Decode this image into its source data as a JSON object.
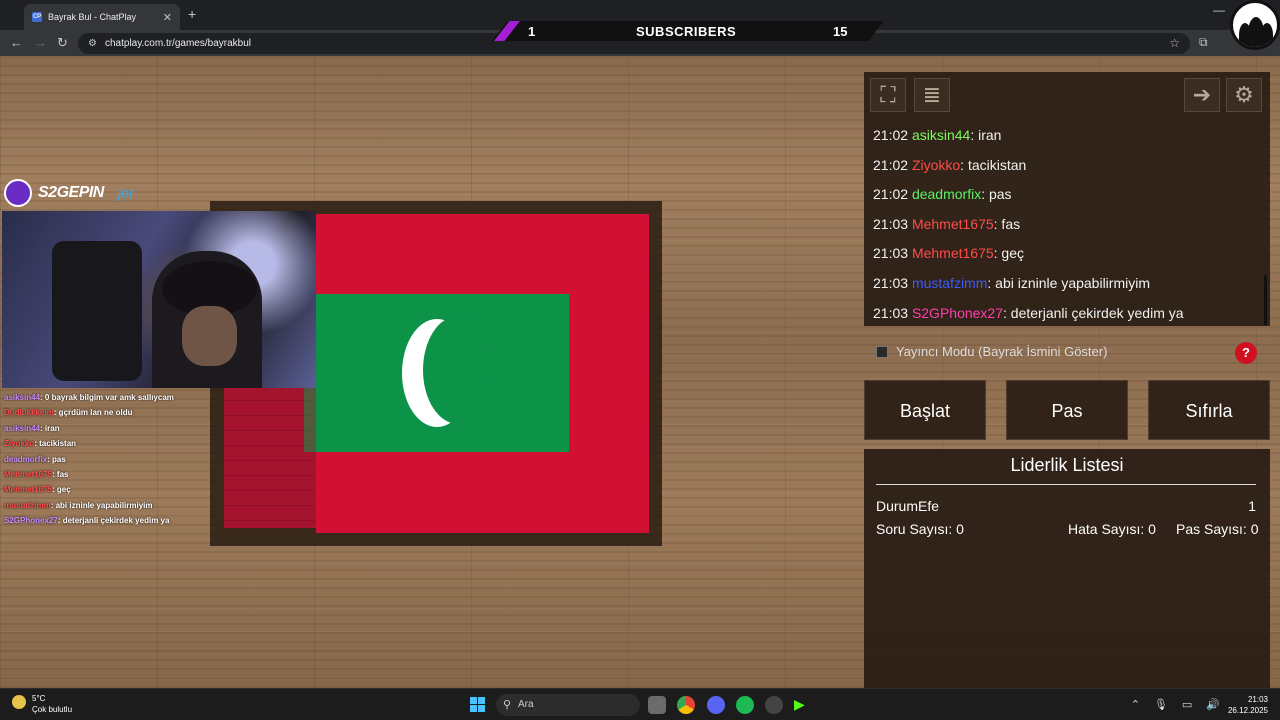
{
  "browser": {
    "tab_title": "Bayrak Bul - ChatPlay",
    "tab_favicon": "CP",
    "url": "chatplay.com.tr/games/bayrakbul"
  },
  "overlay": {
    "sub_left": "1",
    "sub_label": "SUBSCRIBERS",
    "sub_right": "15",
    "brand_name": "S2GEPIN",
    "sponsor": "jet"
  },
  "mini_chat": [
    {
      "user": "asiksin44",
      "text": ": 0 bayrak bilgim var amk sallıycam",
      "color": "purple"
    },
    {
      "user": "Dudiukkkeim",
      "text": ": gçrdüm lan ne oldu",
      "color": "red"
    },
    {
      "user": "asiksin44",
      "text": ": iran",
      "color": "purple"
    },
    {
      "user": "Ziyokko",
      "text": ": tacikistan",
      "color": "red"
    },
    {
      "user": "deadmorfix",
      "text": ": pas",
      "color": "purple"
    },
    {
      "user": "Mehmet1675",
      "text": ": fas",
      "color": "red"
    },
    {
      "user": "Mehmet1675",
      "text": ": geç",
      "color": "red"
    },
    {
      "user": "mustafzimm",
      "text": ": abi izninle yapabilirmiyim",
      "color": "red"
    },
    {
      "user": "S2GPhonex27",
      "text": ": deterjanli çekirdek yedim ya",
      "color": "purple"
    }
  ],
  "chat": [
    {
      "time": "21:02",
      "user": "asiksin44",
      "text": ": iran",
      "color": "#7cfc5a"
    },
    {
      "time": "21:02",
      "user": "Ziyokko",
      "text": ": tacikistan",
      "color": "#ff4b4b"
    },
    {
      "time": "21:02",
      "user": "deadmorfix",
      "text": ": pas",
      "color": "#5cf06a"
    },
    {
      "time": "21:03",
      "user": "Mehmet1675",
      "text": ": fas",
      "color": "#ff4b4b"
    },
    {
      "time": "21:03",
      "user": "Mehmet1675",
      "text": ": geç",
      "color": "#ff4b4b"
    },
    {
      "time": "21:03",
      "user": "mustafzimm",
      "text": ": abi izninle yapabilirmiyim",
      "color": "#3b5bff"
    },
    {
      "time": "21:03",
      "user": "S2GPhonex27",
      "text": ": deterjanli çekirdek yedim ya",
      "color": "#ff3fb0"
    }
  ],
  "controls": {
    "streamer_mode": "Yayıncı Modu (Bayrak İsmini Göster)",
    "help": "?",
    "start": "Başlat",
    "pass": "Pas",
    "reset": "Sıfırla"
  },
  "leaderboard": {
    "title": "Liderlik Listesi",
    "player": "DurumEfe",
    "score": "1",
    "questions": "Soru Sayısı: 0",
    "errors": "Hata Sayısı: 0",
    "passes": "Pas Sayısı: 0"
  },
  "taskbar": {
    "temp": "5°C",
    "weather": "Çok bulutlu",
    "search": "Ara",
    "time": "21:03",
    "date": "26.12.2025"
  }
}
